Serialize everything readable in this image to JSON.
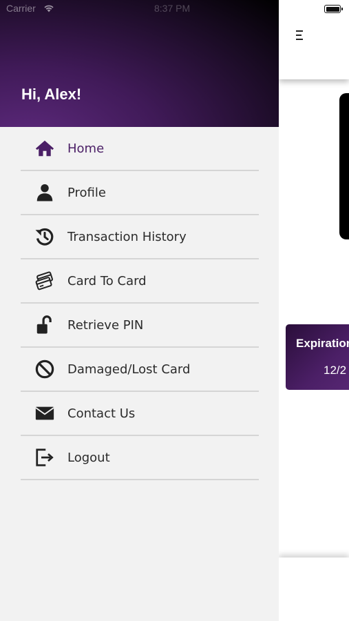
{
  "status_bar": {
    "carrier": "Carrier",
    "time": "8:37 PM"
  },
  "drawer": {
    "greeting": "Hi, Alex!",
    "items": [
      {
        "label": "Home",
        "icon": "home-icon",
        "active": true
      },
      {
        "label": "Profile",
        "icon": "user-icon"
      },
      {
        "label": "Transaction History",
        "icon": "history-icon"
      },
      {
        "label": "Card To Card",
        "icon": "cards-icon"
      },
      {
        "label": "Retrieve PIN",
        "icon": "unlock-icon"
      },
      {
        "label": "Damaged/Lost Card",
        "icon": "ban-icon"
      },
      {
        "label": "Contact Us",
        "icon": "envelope-icon"
      },
      {
        "label": "Logout",
        "icon": "logout-icon"
      }
    ]
  },
  "background": {
    "expiration_label": "Expiration",
    "expiration_value": "12/2"
  },
  "colors": {
    "accent": "#4b1f66",
    "header_dark": "#000000",
    "drawer_bg": "#f2f2f2",
    "divider": "#d5d5d5",
    "text": "#2b2b2b"
  }
}
